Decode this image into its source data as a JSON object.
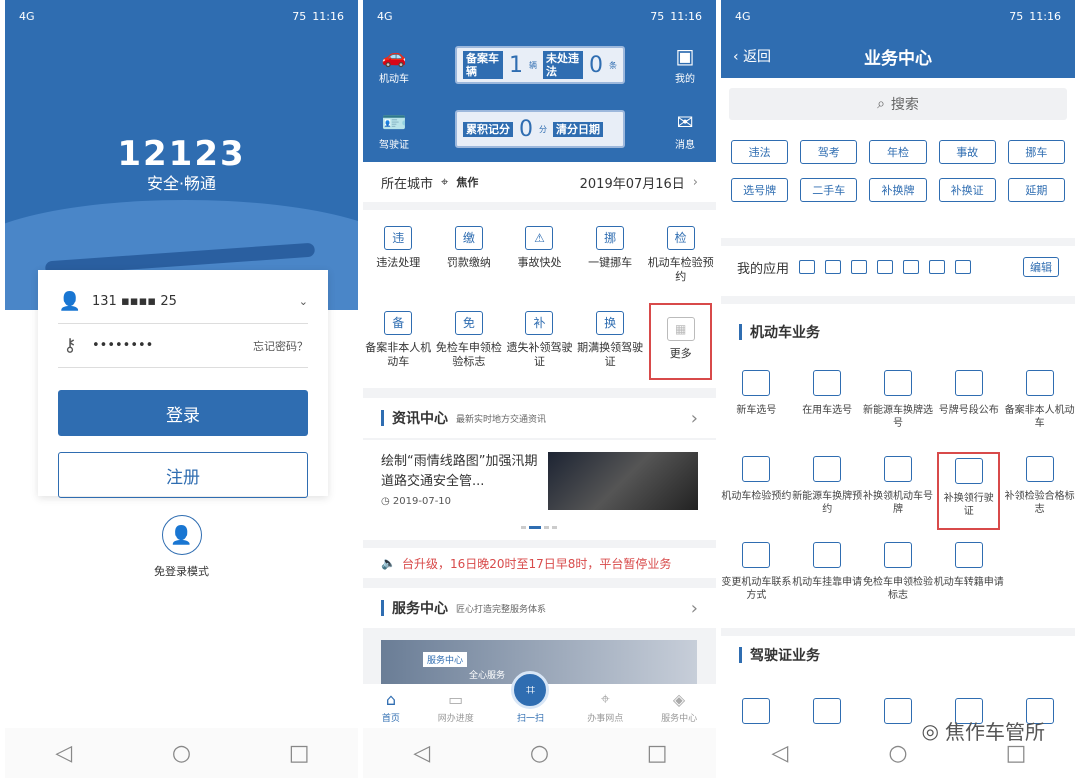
{
  "status": {
    "time": "11:16",
    "battery": "75",
    "signal": "4G"
  },
  "login": {
    "logo": "12123",
    "slogan": "安全·畅通",
    "phone_prefix": "131",
    "phone_suffix": "25",
    "password": "••••••••",
    "forgot": "忘记密码？",
    "login_btn": "登录",
    "register_btn": "注册",
    "guest": "免登录模式"
  },
  "home": {
    "left_icons": [
      "机动车",
      "驾驶证"
    ],
    "right_icons": [
      "我的",
      "消息"
    ],
    "plate1": {
      "tag1": "备案车辆",
      "num1": "1",
      "unit1": "辆",
      "tag2": "未处违法",
      "num2": "0",
      "unit2": "条"
    },
    "plate2": {
      "tag1": "累积记分",
      "num1": "0",
      "unit1": "分",
      "tag2": "清分日期"
    },
    "city_label": "所在城市",
    "city": "焦作",
    "date": "2019年07月16日",
    "grid": [
      "违法处理",
      "罚款缴纳",
      "事故快处",
      "一键挪车",
      "机动车检验预约",
      "备案非本人机动车",
      "免检车申领检验标志",
      "遗失补领驾驶证",
      "期满换领驾驶证",
      "更多"
    ],
    "info_title": "资讯中心",
    "info_sub": "最新实时地方交通资讯",
    "news_title": "绘制“雨情线路图”加强汛期道路交通安全管...",
    "news_date": "2019-07-10",
    "notice": "台升级，16日晚20时至17日早8时，平台暂停业务",
    "svc_title": "服务中心",
    "svc_sub": "匠心打造完整服务体系",
    "svc_img_label": "服务中心",
    "svc_img_text": "全心服务",
    "tabs": [
      "首页",
      "网办进度",
      "扫一扫",
      "办事网点",
      "服务中心"
    ]
  },
  "biz": {
    "back": "返回",
    "title": "业务中心",
    "search": "搜索",
    "chips": [
      "违法",
      "驾考",
      "年检",
      "事故",
      "挪车",
      "选号牌",
      "二手车",
      "补换牌",
      "补换证",
      "延期"
    ],
    "my_apps": "我的应用",
    "edit": "编辑",
    "sec1": "机动车业务",
    "items": [
      "新车选号",
      "在用车选号",
      "新能源车换牌选号",
      "号牌号段公布",
      "备案非本人机动车",
      "机动车检验预约",
      "新能源车换牌预约",
      "补换领机动车号牌",
      "补换领行驶证",
      "补领检验合格标志",
      "变更机动车联系方式",
      "机动车挂靠申请",
      "免检车申领检验标志",
      "机动车转籍申请"
    ],
    "sec2": "驾驶证业务",
    "watermark": "焦作车管所"
  }
}
